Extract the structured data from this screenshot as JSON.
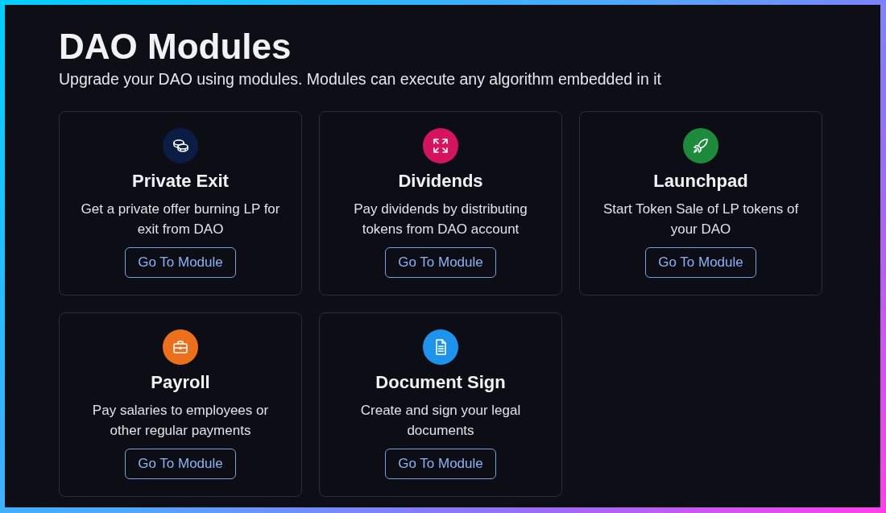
{
  "header": {
    "title": "DAO Modules",
    "subtitle": "Upgrade your DAO using modules. Modules can execute any algorithm embedded in it"
  },
  "modules": [
    {
      "kind": "coins",
      "color": "#0b1d44",
      "title": "Private Exit",
      "description": "Get a private offer burning LP for exit from DAO",
      "button": "Go To Module"
    },
    {
      "kind": "arrows",
      "color": "#d4145f",
      "title": "Dividends",
      "description": "Pay dividends by distributing tokens from DAO account",
      "button": "Go To Module"
    },
    {
      "kind": "rocket",
      "color": "#1e8a3c",
      "title": "Launchpad",
      "description": "Start Token Sale of LP tokens of your DAO",
      "button": "Go To Module"
    },
    {
      "kind": "briefcase",
      "color": "#ec6f1c",
      "title": "Payroll",
      "description": "Pay salaries to employees or other regular payments",
      "button": "Go To Module"
    },
    {
      "kind": "document",
      "color": "#1e93ee",
      "title": "Document Sign",
      "description": "Create and sign your legal documents",
      "button": "Go To Module"
    }
  ]
}
